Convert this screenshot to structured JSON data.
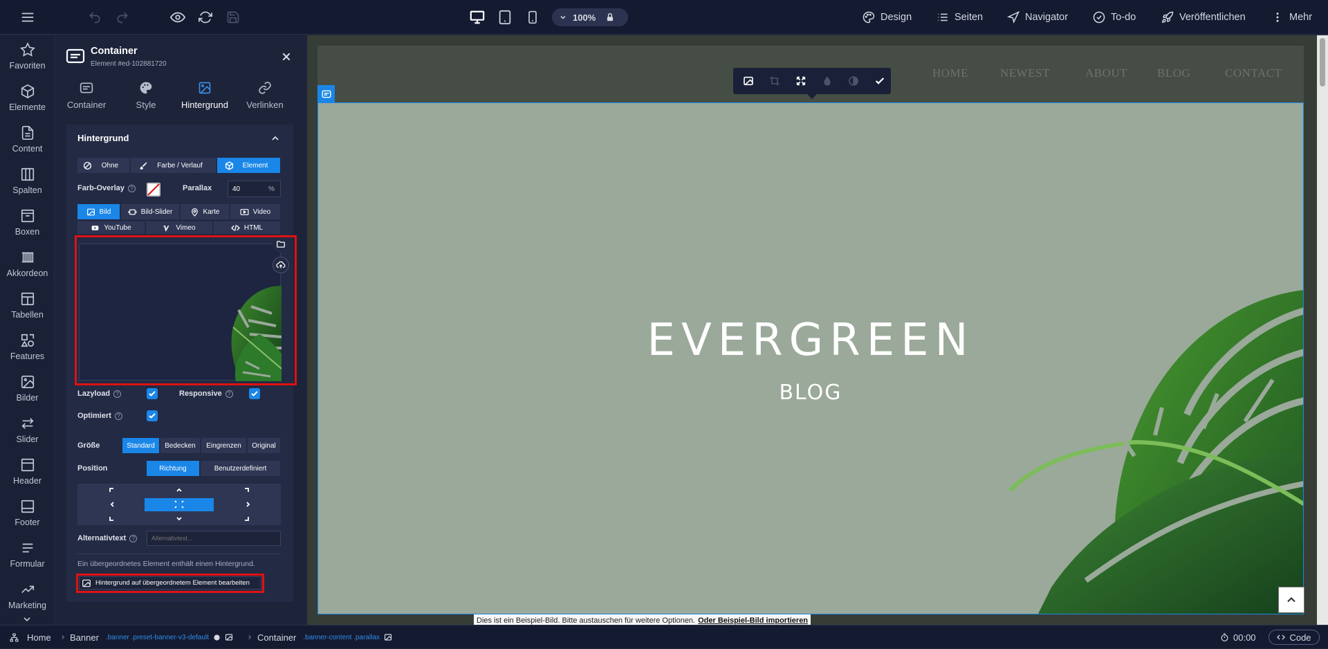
{
  "toolbar": {
    "zoom": "100%",
    "menu": [
      {
        "label": "Design",
        "icon": "palette-icon"
      },
      {
        "label": "Seiten",
        "icon": "list-icon"
      },
      {
        "label": "Navigator",
        "icon": "navigator-icon"
      },
      {
        "label": "To-do",
        "icon": "check-circle-icon"
      },
      {
        "label": "Veröffentlichen",
        "icon": "rocket-icon"
      },
      {
        "label": "Mehr",
        "icon": "more-vertical-icon"
      }
    ]
  },
  "sidebar": {
    "items": [
      {
        "label": "Favoriten",
        "icon": "star-icon"
      },
      {
        "label": "Elemente",
        "icon": "cube-icon"
      },
      {
        "label": "Content",
        "icon": "document-icon"
      },
      {
        "label": "Spalten",
        "icon": "columns-icon"
      },
      {
        "label": "Boxen",
        "icon": "box-icon"
      },
      {
        "label": "Akkordeon",
        "icon": "accordion-icon"
      },
      {
        "label": "Tabellen",
        "icon": "table-icon"
      },
      {
        "label": "Features",
        "icon": "features-icon"
      },
      {
        "label": "Bilder",
        "icon": "image-icon"
      },
      {
        "label": "Slider",
        "icon": "slider-icon"
      },
      {
        "label": "Header",
        "icon": "header-icon"
      },
      {
        "label": "Footer",
        "icon": "footer-icon"
      },
      {
        "label": "Formular",
        "icon": "form-icon"
      },
      {
        "label": "Marketing",
        "icon": "chart-icon"
      }
    ]
  },
  "panel": {
    "title": "Container",
    "subtitle": "Element #ed-102881720",
    "tabs": [
      {
        "label": "Container"
      },
      {
        "label": "Style"
      },
      {
        "label": "Hintergrund"
      },
      {
        "label": "Verlinken"
      }
    ],
    "section_title": "Hintergrund",
    "bg_types": [
      "Ohne",
      "Farbe / Verlauf",
      "Element"
    ],
    "farb_overlay_label": "Farb-Overlay",
    "parallax_label": "Parallax",
    "parallax_value": "40",
    "parallax_unit": "%",
    "media_types_row1": [
      "Bild",
      "Bild-Slider",
      "Karte",
      "Video"
    ],
    "media_types_row2": [
      "YouTube",
      "Vimeo",
      "HTML"
    ],
    "lazyload_label": "Lazyload",
    "responsive_label": "Responsive",
    "optimiert_label": "Optimiert",
    "groesse_label": "Größe",
    "groesse_options": [
      "Standard",
      "Bedecken",
      "Eingrenzen",
      "Original"
    ],
    "position_label": "Position",
    "position_options": [
      "Richtung",
      "Benutzerdefiniert"
    ],
    "alt_label": "Alternativtext",
    "alt_placeholder": "Alternativtext...",
    "parent_notice": "Ein übergeordnetes Element enthält einen Hintergrund.",
    "parent_button": "Hintergrund auf übergeordnetem Element bearbeiten"
  },
  "site": {
    "nav": [
      "HOME",
      "NEWEST",
      "ABOUT",
      "BLOG",
      "CONTACT"
    ],
    "title": "EVERGREEN",
    "subtitle": "BLOG",
    "notice_text": "Dies ist ein Beispiel-Bild. Bitte austauschen für weitere Optionen.",
    "notice_link": "Oder Beispiel-Bild importieren"
  },
  "bottombar": {
    "crumbs": [
      {
        "label": "Home",
        "classes": ""
      },
      {
        "label": "Banner",
        "classes": ".banner .preset-banner-v3-default"
      },
      {
        "label": "Container",
        "classes": ".banner-content .parallax"
      }
    ],
    "timer": "00:00",
    "code_label": "Code"
  },
  "colors": {
    "accent": "#1a86e8",
    "highlight": "#e01111",
    "hero_bg": "#9aa99a"
  }
}
